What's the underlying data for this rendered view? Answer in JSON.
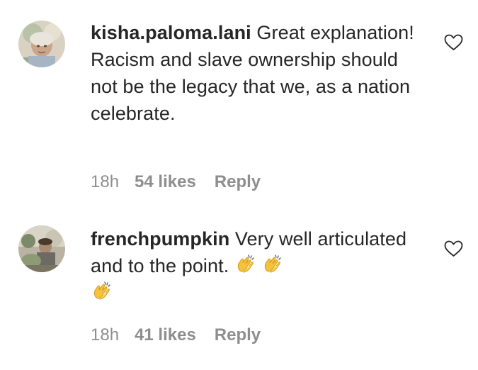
{
  "comments": [
    {
      "username": "kisha.paloma.lani",
      "text": " Great explanation! Racism and slave ownership should not be the legacy that we, as a nation celebrate.",
      "time": "18h",
      "likes": "54 likes",
      "reply": "Reply"
    },
    {
      "username": "frenchpumpkin",
      "text": " Very well articulated and to the point.",
      "emoji": [
        "clapping-hands",
        "clapping-hands",
        "clapping-hands"
      ],
      "time": "18h",
      "likes": "41 likes",
      "reply": "Reply"
    }
  ],
  "icons": {
    "heart": "heart-outline-icon",
    "clap": "clapping-hands-emoji"
  },
  "colors": {
    "text": "#262626",
    "meta": "#8e8e8e",
    "emoji": "#f5c33b"
  }
}
